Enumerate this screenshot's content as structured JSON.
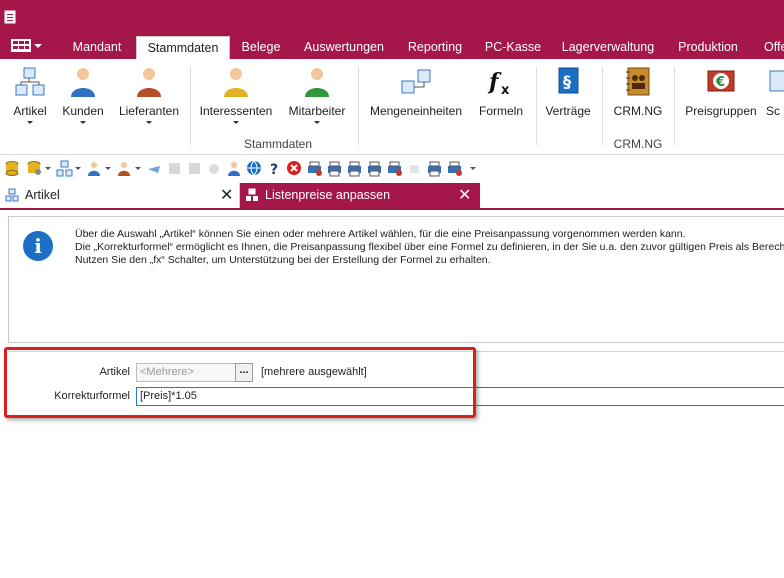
{
  "ribbon_tabs": [
    {
      "label": "Mandant"
    },
    {
      "label": "Stammdaten"
    },
    {
      "label": "Belege"
    },
    {
      "label": "Auswertungen"
    },
    {
      "label": "Reporting"
    },
    {
      "label": "PC-Kasse"
    },
    {
      "label": "Lagerverwaltung"
    },
    {
      "label": "Produktion"
    },
    {
      "label": "Offe"
    }
  ],
  "ribbon": {
    "buttons": [
      {
        "label": "Artikel",
        "icon": "articles-icon"
      },
      {
        "label": "Kunden",
        "icon": "customer-icon"
      },
      {
        "label": "Lieferanten",
        "icon": "supplier-icon"
      },
      {
        "label": "Interessenten",
        "icon": "prospect-icon"
      },
      {
        "label": "Mitarbeiter",
        "icon": "employee-icon"
      },
      {
        "label": "Mengeneinheiten",
        "icon": "units-icon"
      },
      {
        "label": "Formeln",
        "icon": "formula-icon"
      },
      {
        "label": "Verträge",
        "icon": "contract-icon"
      },
      {
        "label": "CRM.NG",
        "icon": "crm-icon"
      },
      {
        "label": "Preisgruppen",
        "icon": "price-groups-icon"
      },
      {
        "label": "Sc",
        "icon": "truncated-icon"
      }
    ],
    "group_labels": {
      "stammdaten": "Stammdaten",
      "crm": "CRM.NG"
    }
  },
  "doc_tabs": [
    {
      "label": "Artikel",
      "close": "✕"
    },
    {
      "label": "Listenpreise anpassen",
      "close": "✕"
    }
  ],
  "info": {
    "icon_glyph": "i",
    "lines": [
      "Über die Auswahl „Artikel“ können Sie einen oder mehrere Artikel wählen, für die eine Preisanpassung vorgenommen werden kann.",
      "Die „Korrekturformel“ ermöglicht es Ihnen, die Preisanpassung flexibel über eine Formel zu definieren, in der Sie u.a. den zuvor gültigen Preis als Berech",
      "Nutzen Sie den „fx“ Schalter, um Unterstützung bei der Erstellung der Formel zu erhalten."
    ]
  },
  "form": {
    "artikel": {
      "label": "Artikel",
      "value": "<Mehrere>",
      "browse": "...",
      "selection_text": "[mehrere ausgewählt]"
    },
    "korrekturformel": {
      "label": "Korrekturformel",
      "value": "[Preis]*1.05"
    }
  },
  "colors": {
    "accent": "#a5174a",
    "highlight_box": "#d9201f",
    "info_blue": "#1b6fc4",
    "focus": "#1b7bd6"
  }
}
